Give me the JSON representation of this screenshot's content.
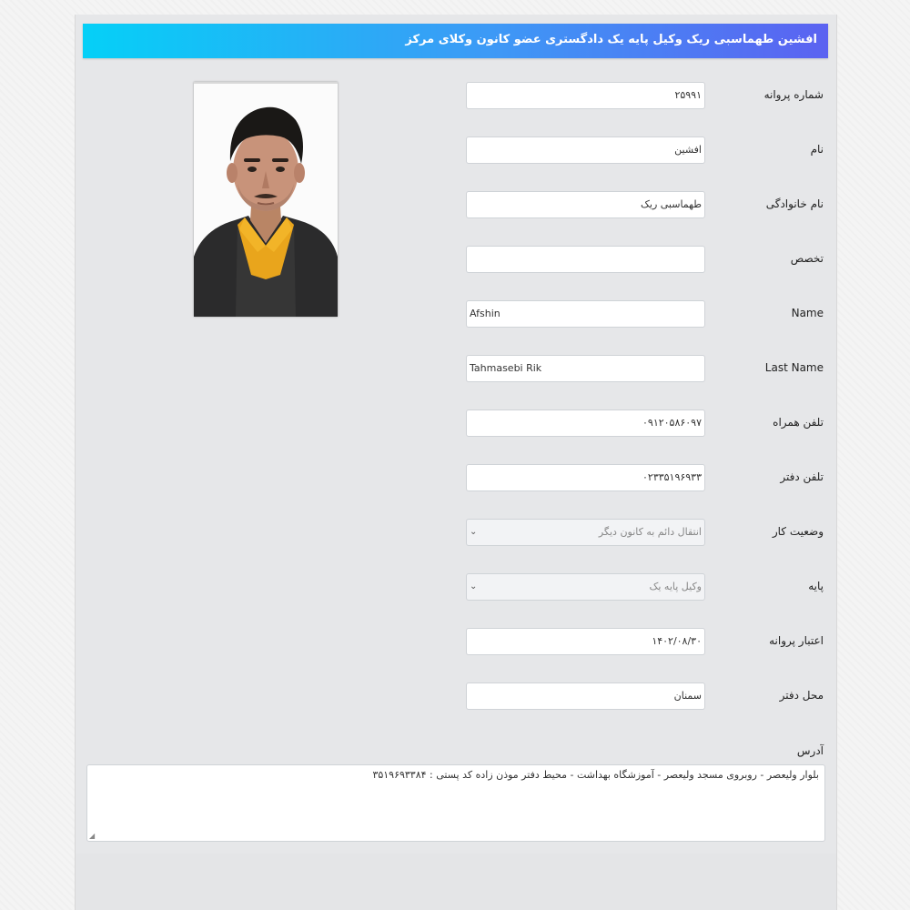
{
  "header": {
    "title": "افشین طهماسبی ریک وکیل پایه یک دادگستری عضو کانون وکلای مرکز"
  },
  "fields": {
    "license_number": {
      "label": "شماره پروانه",
      "value": "۲۵۹۹۱"
    },
    "first_name": {
      "label": "نام",
      "value": "افشین"
    },
    "last_name": {
      "label": "نام خانوادگی",
      "value": "طهماسبی ریک"
    },
    "specialty": {
      "label": "تخصص",
      "value": ""
    },
    "name_en": {
      "label": "Name",
      "value": "Afshin"
    },
    "last_name_en": {
      "label": "Last Name",
      "value": "Tahmasebi Rik"
    },
    "mobile": {
      "label": "تلفن همراه",
      "value": "۰۹۱۲۰۵۸۶۰۹۷"
    },
    "office_phone": {
      "label": "تلفن دفتر",
      "value": "۰۲۳۳۵۱۹۶۹۳۳"
    },
    "work_status": {
      "label": "وضعیت کار",
      "value": "انتقال دائم به کانون دیگر"
    },
    "grade": {
      "label": "پایه",
      "value": "وکیل پایه یک"
    },
    "license_validity": {
      "label": "اعتبار پروانه",
      "value": "۱۴۰۲/۰۸/۳۰"
    },
    "office_location": {
      "label": "محل دفتر",
      "value": "سمنان"
    }
  },
  "address": {
    "label": "آدرس",
    "value": "بلوار ولیعصر - روبروی مسجد ولیعصر - آموزشگاه بهداشت - محیط دفتر موذن زاده کد پستی : ۳۵۱۹۶۹۳۳۸۴"
  },
  "icons": {
    "select_caret": "chevron-down-icon",
    "photo": "lawyer-portrait"
  },
  "colors": {
    "header_gradient_start": "#05d0f7",
    "header_gradient_end": "#5b62f1",
    "panel_background": "#e6e7e9"
  }
}
